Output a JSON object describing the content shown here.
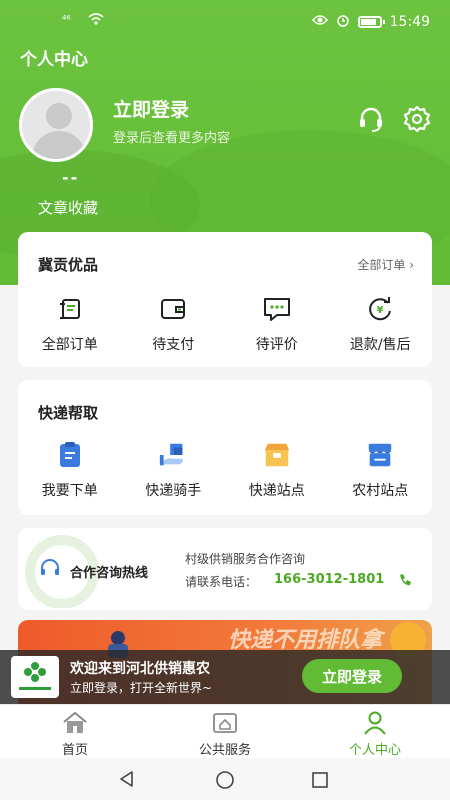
{
  "status_bar": {
    "signal_text": "⁴⁶",
    "time": "15:49"
  },
  "header": {
    "title": "个人中心",
    "login_title": "立即登录",
    "login_subtitle": "登录后查看更多内容",
    "collect_count": "--",
    "collect_label": "文章收藏",
    "icons": [
      "headset-icon",
      "gear-icon"
    ]
  },
  "orders_card": {
    "title": "冀贡优品",
    "link": "全部订单 ›",
    "items": [
      {
        "label": "全部订单",
        "icon": "order-list-icon"
      },
      {
        "label": "待支付",
        "icon": "wallet-icon"
      },
      {
        "label": "待评价",
        "icon": "comment-icon"
      },
      {
        "label": "退款/售后",
        "icon": "refund-icon"
      }
    ]
  },
  "express_card": {
    "title": "快递帮取",
    "items": [
      {
        "label": "我要下单",
        "icon": "clipboard-icon"
      },
      {
        "label": "快递骑手",
        "icon": "courier-icon"
      },
      {
        "label": "快递站点",
        "icon": "parcel-station-icon"
      },
      {
        "label": "农村站点",
        "icon": "rural-station-icon"
      }
    ]
  },
  "hotline": {
    "title": "合作咨询热线",
    "description": "村级供销服务合作咨询",
    "phone_label": "请联系电话：",
    "phone": "166-3012-1801"
  },
  "banner": {
    "text": "快递不用排队拿"
  },
  "promo": {
    "line1": "欢迎来到河北供销惠农",
    "line2": "立即登录，打开全新世界~",
    "button": "立即登录"
  },
  "tabbar": [
    {
      "label": "首页",
      "icon": "home-icon"
    },
    {
      "label": "公共服务",
      "icon": "service-icon"
    },
    {
      "label": "个人中心",
      "icon": "person-icon",
      "active": true
    }
  ],
  "colors": {
    "brand_green": "#62bb35",
    "accent_green": "#4aab22",
    "promo_bg": "#282828"
  }
}
